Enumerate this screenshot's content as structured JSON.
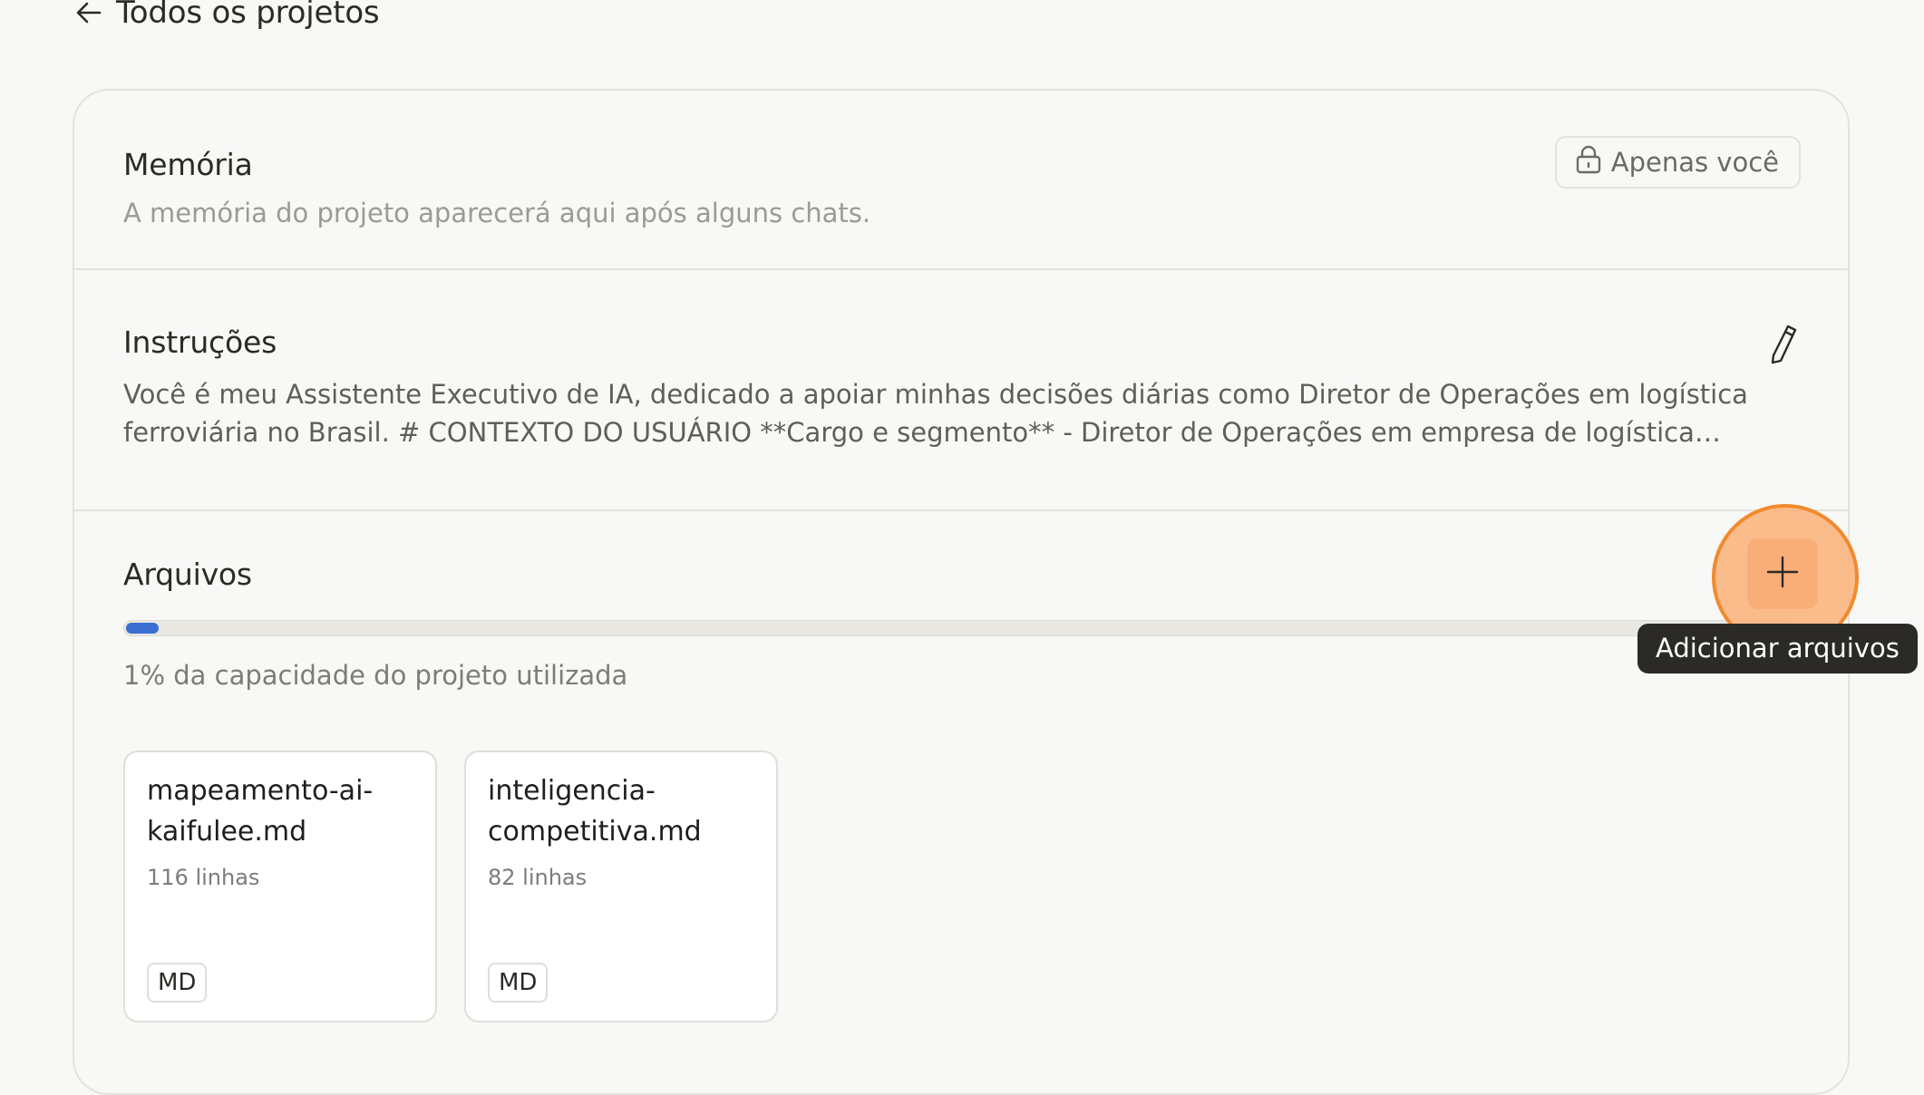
{
  "nav": {
    "back_label": "Todos os projetos"
  },
  "memory": {
    "title": "Memória",
    "subtitle": "A memória do projeto aparecerá aqui após alguns chats.",
    "visibility_label": "Apenas você"
  },
  "instructions": {
    "title": "Instruções",
    "text": "Você é meu Assistente Executivo de IA, dedicado a apoiar minhas decisões diárias como Diretor de Operações em logística ferroviária no Brasil. # CONTEXTO DO USUÁRIO **Cargo e segmento** - Diretor de Operações em empresa de logística ferroviária no Brasil"
  },
  "files": {
    "title": "Arquivos",
    "capacity_percent": 1,
    "capacity_text": "1% da capacidade do projeto utilizada",
    "add_tooltip": "Adicionar arquivos",
    "items": [
      {
        "name": "mapeamento-ai-kaifulee.md",
        "lines": "116 linhas",
        "badge": "MD"
      },
      {
        "name": "inteligencia-competitiva.md",
        "lines": "82 linhas",
        "badge": "MD"
      }
    ]
  },
  "icons": {
    "back": "arrow-left-icon",
    "lock": "lock-icon",
    "edit": "pencil-icon",
    "add": "plus-icon"
  },
  "colors": {
    "background": "#f8f8f6",
    "progress_fill": "#3a6fd2",
    "highlight": "#f28a2e",
    "tooltip_bg": "#2b2a27"
  }
}
